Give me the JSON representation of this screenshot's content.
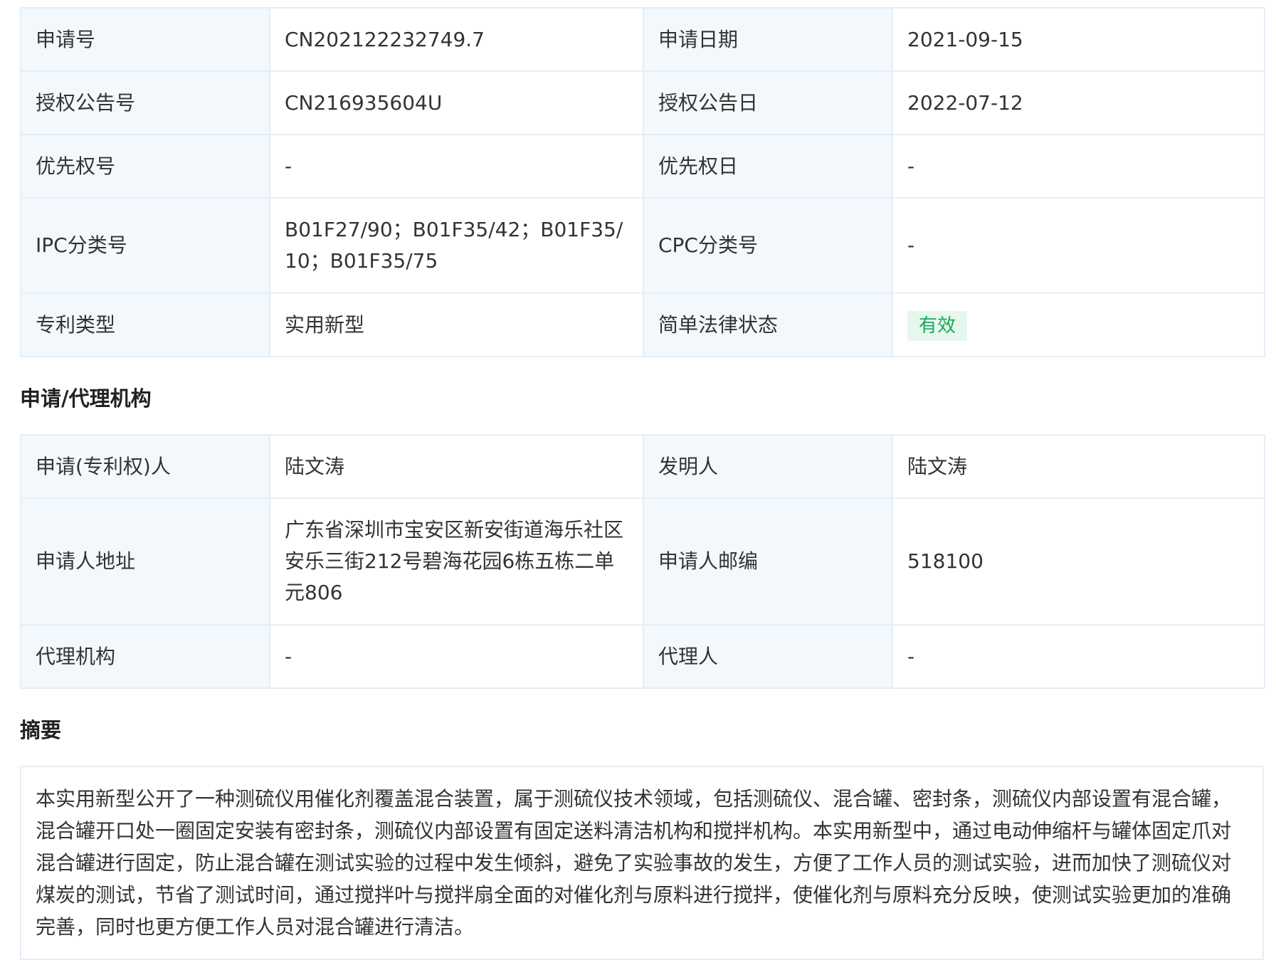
{
  "basic_info": {
    "rows": [
      {
        "l1": "申请号",
        "v1": "CN202122232749.7",
        "l2": "申请日期",
        "v2": "2021-09-15"
      },
      {
        "l1": "授权公告号",
        "v1": "CN216935604U",
        "l2": "授权公告日",
        "v2": "2022-07-12"
      },
      {
        "l1": "优先权号",
        "v1": "-",
        "l2": "优先权日",
        "v2": "-"
      },
      {
        "l1": "IPC分类号",
        "v1": "B01F27/90；B01F35/42；B01F35/10；B01F35/75",
        "l2": "CPC分类号",
        "v2": "-"
      },
      {
        "l1": "专利类型",
        "v1": "实用新型",
        "l2": "简单法律状态",
        "v2": "有效"
      }
    ],
    "status_color": "#1aa857",
    "status_bg": "#e6f7ee"
  },
  "agency_section": {
    "title": "申请/代理机构",
    "rows": [
      {
        "l1": "申请(专利权)人",
        "v1": "陆文涛",
        "l2": "发明人",
        "v2": "陆文涛"
      },
      {
        "l1": "申请人地址",
        "v1": "广东省深圳市宝安区新安街道海乐社区安乐三街212号碧海花园6栋五栋二单元806",
        "l2": "申请人邮编",
        "v2": "518100"
      },
      {
        "l1": "代理机构",
        "v1": "-",
        "l2": "代理人",
        "v2": "-"
      }
    ]
  },
  "abstract_section": {
    "title": "摘要",
    "text": "本实用新型公开了一种测硫仪用催化剂覆盖混合装置，属于测硫仪技术领域，包括测硫仪、混合罐、密封条，测硫仪内部设置有混合罐，混合罐开口处一圈固定安装有密封条，测硫仪内部设置有固定送料清洁机构和搅拌机构。本实用新型中，通过电动伸缩杆与罐体固定爪对混合罐进行固定，防止混合罐在测试实验的过程中发生倾斜，避免了实验事故的发生，方便了工作人员的测试实验，进而加快了测硫仪对煤炭的测试，节省了测试时间，通过搅拌叶与搅拌扇全面的对催化剂与原料进行搅拌，使催化剂与原料充分反映，使测试实验更加的准确完善，同时也更方便工作人员对混合罐进行清洁。"
  },
  "colors": {
    "label_bg": "#f3f8fd",
    "border": "#e4eef7"
  }
}
